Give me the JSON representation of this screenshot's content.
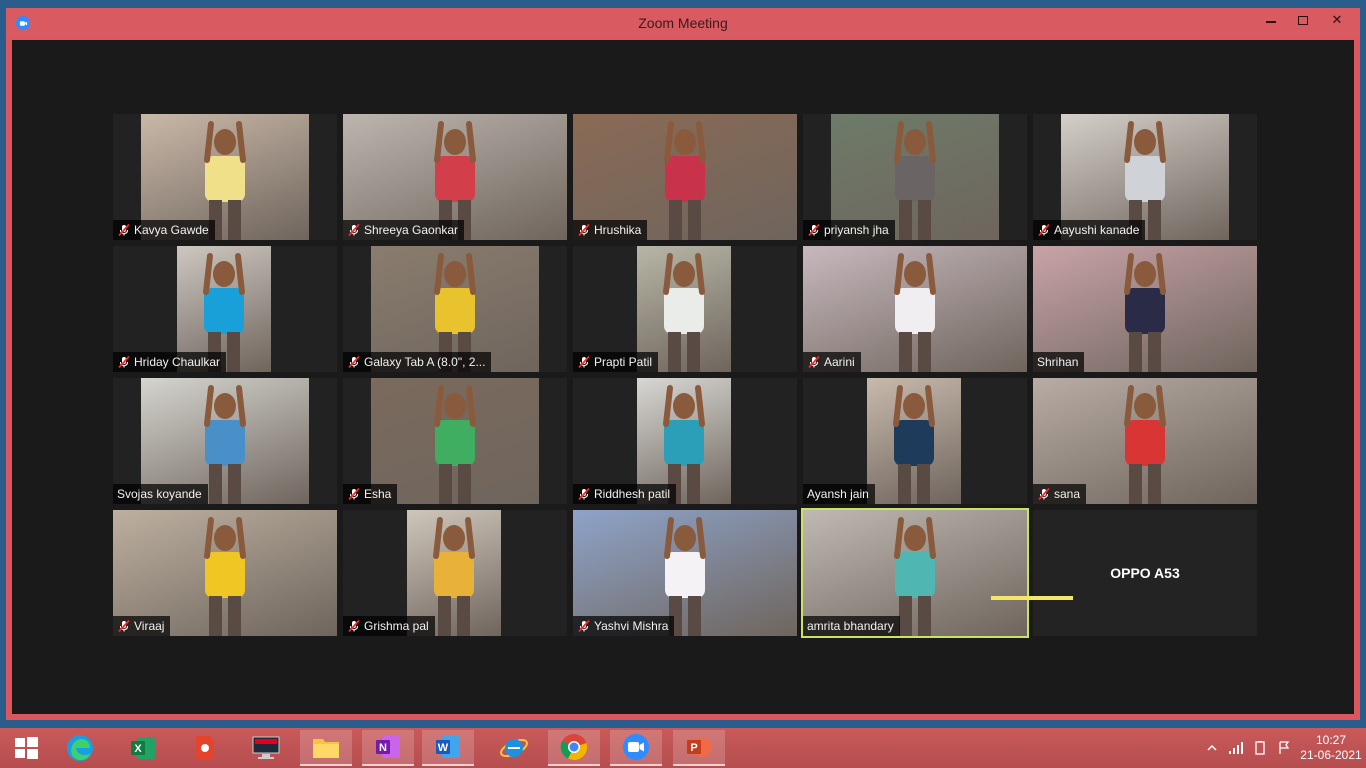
{
  "window": {
    "title": "Zoom Meeting"
  },
  "participants": [
    {
      "name": "Kavya Gawde",
      "muted": true,
      "bg": "#c9b8a8",
      "fig": "#f1e08a",
      "vx": 28,
      "vw": 168
    },
    {
      "name": "Shreeya Gaonkar",
      "muted": true,
      "bg": "#bdb6ae",
      "fig": "#d23f4a",
      "vx": 0,
      "vw": 224
    },
    {
      "name": "Hrushika",
      "muted": true,
      "bg": "#8a6a55",
      "fig": "#c8324a",
      "vx": 0,
      "vw": 224
    },
    {
      "name": "priyansh jha",
      "muted": true,
      "bg": "#6d7b69",
      "fig": "#6b6464",
      "vx": 28,
      "vw": 168
    },
    {
      "name": "Aayushi kanade",
      "muted": true,
      "bg": "#d4cfc9",
      "fig": "#cfd2d6",
      "vx": 28,
      "vw": 168
    },
    {
      "name": "Hriday Chaulkar",
      "muted": true,
      "bg": "#ccc7c0",
      "fig": "#1aa0d8",
      "vx": 64,
      "vw": 94
    },
    {
      "name": "Galaxy Tab A (8.0\", 2...",
      "muted": true,
      "bg": "#8a7d6f",
      "fig": "#e8c32e",
      "vx": 28,
      "vw": 168
    },
    {
      "name": "Prapti Patil",
      "muted": true,
      "bg": "#b7b6a6",
      "fig": "#e9ece9",
      "vx": 64,
      "vw": 94
    },
    {
      "name": "Aarini",
      "muted": true,
      "bg": "#c7b8bd",
      "fig": "#f1eef2",
      "vx": 0,
      "vw": 224
    },
    {
      "name": "Shrihan",
      "muted": false,
      "bg": "#c8a3a8",
      "fig": "#2a2c47",
      "vx": 0,
      "vw": 224
    },
    {
      "name": "Svojas koyande",
      "muted": false,
      "bg": "#d5d4cf",
      "fig": "#4a90c8",
      "vx": 28,
      "vw": 168
    },
    {
      "name": "Esha",
      "muted": true,
      "bg": "#7b6a5d",
      "fig": "#3fae60",
      "vx": 28,
      "vw": 168
    },
    {
      "name": "Riddhesh patil",
      "muted": true,
      "bg": "#d8d7d3",
      "fig": "#2a9fb7",
      "vx": 64,
      "vw": 94
    },
    {
      "name": "Ayansh jain",
      "muted": false,
      "bg": "#c8b9ac",
      "fig": "#1f3b5c",
      "vx": 64,
      "vw": 94
    },
    {
      "name": "sana",
      "muted": true,
      "bg": "#b8aca5",
      "fig": "#d93535",
      "vx": 0,
      "vw": 224
    },
    {
      "name": "Viraaj",
      "muted": true,
      "bg": "#bdb0a0",
      "fig": "#f0c624",
      "vx": 0,
      "vw": 224
    },
    {
      "name": "Grishma pal",
      "muted": true,
      "bg": "#cfc6bb",
      "fig": "#e8b23a",
      "vx": 64,
      "vw": 94
    },
    {
      "name": "Yashvi Mishra",
      "muted": true,
      "bg": "#8ea3c9",
      "fig": "#f4f2f4",
      "vx": 0,
      "vw": 224
    },
    {
      "name": "amrita bhandary",
      "muted": false,
      "bg": "#bfb9b1",
      "fig": "#4fb6b2",
      "vx": 0,
      "vw": 224,
      "active": true
    },
    {
      "name": "OPPO A53",
      "muted": false,
      "noimg": true
    }
  ],
  "taskbar": {
    "apps": [
      "windows-start",
      "edge",
      "excel",
      "paint",
      "lenovo",
      "file-explorer",
      "onenote",
      "word",
      "internet-explorer",
      "chrome",
      "zoom",
      "powerpoint"
    ],
    "clock": {
      "time": "10:27",
      "date": "21-06-2021"
    }
  },
  "colors": {
    "titlebar": "#da5a62",
    "stage": "#1a1a1a",
    "active_outline": "#c9e26a",
    "taskbar": "#c35657"
  }
}
